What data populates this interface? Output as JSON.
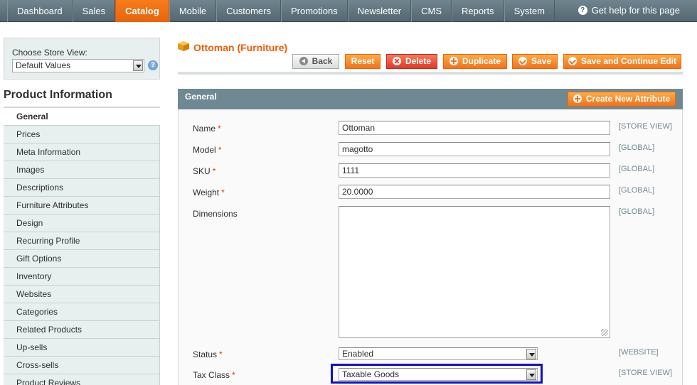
{
  "nav": {
    "items": [
      {
        "label": "Dashboard"
      },
      {
        "label": "Sales"
      },
      {
        "label": "Catalog",
        "active": true
      },
      {
        "label": "Mobile"
      },
      {
        "label": "Customers"
      },
      {
        "label": "Promotions"
      },
      {
        "label": "Newsletter"
      },
      {
        "label": "CMS"
      },
      {
        "label": "Reports"
      },
      {
        "label": "System"
      }
    ],
    "help": "Get help for this page"
  },
  "store_view": {
    "label": "Choose Store View:",
    "selected": "Default Values"
  },
  "sidebar": {
    "title": "Product Information",
    "tabs": [
      {
        "label": "General",
        "active": true
      },
      {
        "label": "Prices"
      },
      {
        "label": "Meta Information"
      },
      {
        "label": "Images"
      },
      {
        "label": "Descriptions"
      },
      {
        "label": "Furniture Attributes"
      },
      {
        "label": "Design"
      },
      {
        "label": "Recurring Profile"
      },
      {
        "label": "Gift Options"
      },
      {
        "label": "Inventory"
      },
      {
        "label": "Websites"
      },
      {
        "label": "Categories"
      },
      {
        "label": "Related Products"
      },
      {
        "label": "Up-sells"
      },
      {
        "label": "Cross-sells"
      },
      {
        "label": "Product Reviews"
      }
    ]
  },
  "header": {
    "title": "Ottoman (Furniture)",
    "buttons": {
      "back": "Back",
      "reset": "Reset",
      "delete": "Delete",
      "duplicate": "Duplicate",
      "save": "Save",
      "save_continue": "Save and Continue Edit"
    }
  },
  "fieldset": {
    "title": "General",
    "create_attribute": "Create New Attribute",
    "fields": {
      "name": {
        "label": "Name",
        "value": "Ottoman",
        "scope": "[STORE VIEW]"
      },
      "model": {
        "label": "Model",
        "value": "magotto",
        "scope": "[GLOBAL]"
      },
      "sku": {
        "label": "SKU",
        "value": "1111",
        "scope": "[GLOBAL]"
      },
      "weight": {
        "label": "Weight",
        "value": "20.0000",
        "scope": "[GLOBAL]"
      },
      "dimensions": {
        "label": "Dimensions",
        "value": "",
        "scope": "[GLOBAL]"
      },
      "status": {
        "label": "Status",
        "value": "Enabled",
        "scope": "[WEBSITE]"
      },
      "tax_class": {
        "label": "Tax Class",
        "value": "Taxable Goods",
        "scope": "[STORE VIEW]"
      }
    },
    "required_mark": "*"
  },
  "colors": {
    "accent": "#eb5e00",
    "nav_bg": "#55676f",
    "highlight": "#1010c8"
  }
}
